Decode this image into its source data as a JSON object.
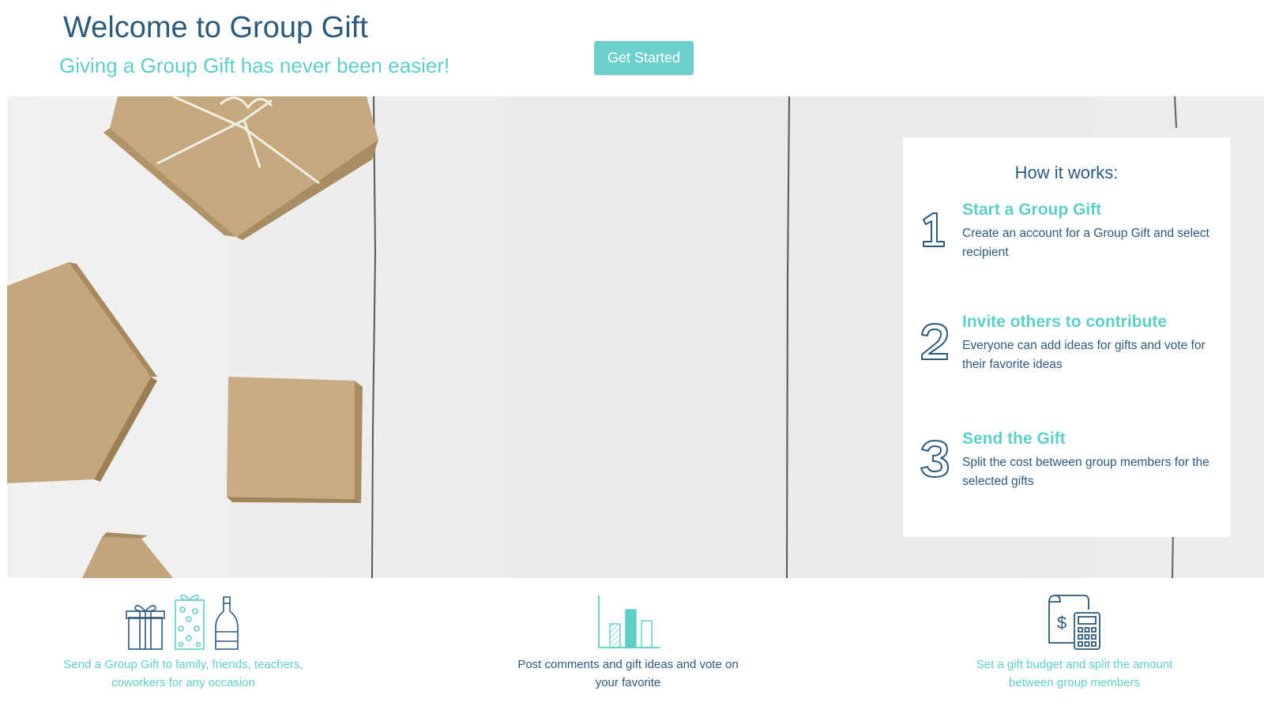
{
  "header": {
    "title": "Welcome to Group Gift",
    "subtitle": "Giving a Group Gift has never been easier!",
    "cta_label": "Get Started"
  },
  "how_it_works": {
    "title": "How it works:",
    "steps": [
      {
        "number": "1",
        "number_icon": "outlined-numeral-1-icon",
        "title": "Start a Group Gift",
        "description": "Create an account for a Group Gift and select recipient"
      },
      {
        "number": "2",
        "number_icon": "outlined-numeral-2-icon",
        "title": "Invite others to contribute",
        "description": "Everyone can add ideas for gifts and vote for their favorite ideas"
      },
      {
        "number": "3",
        "number_icon": "outlined-numeral-3-icon",
        "title": "Send the Gift",
        "description": "Split the cost between group members for the selected gifts"
      }
    ]
  },
  "features": [
    {
      "icon": "gifts-and-bottle-icon",
      "text": "Send a Group Gift to family, friends, teachers, coworkers for any occasion",
      "color": "#5ecec7"
    },
    {
      "icon": "bar-chart-icon",
      "text": "Post comments and gift ideas and vote on your favorite",
      "color": "#2d5a7c"
    },
    {
      "icon": "budget-calculator-icon",
      "text": "Set a gift budget and split the amount between group members",
      "color": "#5ecec7"
    }
  ],
  "colors": {
    "navy": "#2d5a7c",
    "teal": "#5ecec7",
    "button": "#6dcfca",
    "hero_background": "#ebebeb",
    "kraft_box": "#c7ab80"
  }
}
